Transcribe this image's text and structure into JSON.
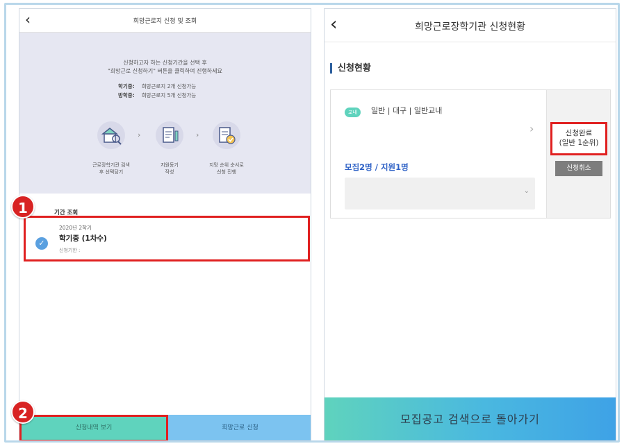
{
  "left": {
    "header": {
      "back_icon": "chevron-left-icon",
      "title": "희망근로지 신청 및 조회"
    },
    "guide": {
      "line1": "신청하고자 하는 신청기간을 선택 후",
      "line2": "\"희망근로 신청하기\" 버튼을 클릭하여 진행하세요",
      "rules": [
        {
          "label": "학기중:",
          "text": "희망근로지 2개 신청가능"
        },
        {
          "label": "방학중:",
          "text": "희망근로지 5개 신청가능"
        }
      ],
      "steps": [
        {
          "icon": "search-building-icon",
          "label1": "근로장학기관 검색",
          "label2": "후 선택담기"
        },
        {
          "icon": "document-write-icon",
          "label1": "지원동기",
          "label2": "작성"
        },
        {
          "icon": "check-document-icon",
          "label1": "지망 순위 순서로",
          "label2": "신청 진행"
        }
      ]
    },
    "period_section_title": "기간 조회",
    "term": {
      "year": "2020년 2학기",
      "name": "학기중 (1차수)",
      "period": "신청기한 :"
    },
    "buttons": {
      "history": "신청내역 보기",
      "apply": "희망근로 신청"
    },
    "badges": [
      "1",
      "2"
    ]
  },
  "right": {
    "header": {
      "back_icon": "chevron-left-icon",
      "title": "희망근로장학기관 신청현황"
    },
    "section_title": "신청현황",
    "card": {
      "tag": "교내",
      "info": "일반 | 대구 | 일반교내",
      "recruit": "모집2명 / 지원1명",
      "status_line1": "신청완료",
      "status_line2": "(일반 1순위)",
      "cancel": "신청취소"
    },
    "bottom_button": "모집공고 검색으로 돌아가기"
  },
  "colors": {
    "accent_mint": "#5fd3bd",
    "accent_blue": "#7cc3f0",
    "highlight_red": "#e02020",
    "guide_bg": "#e6e7f2",
    "link_blue": "#2f62c6"
  }
}
